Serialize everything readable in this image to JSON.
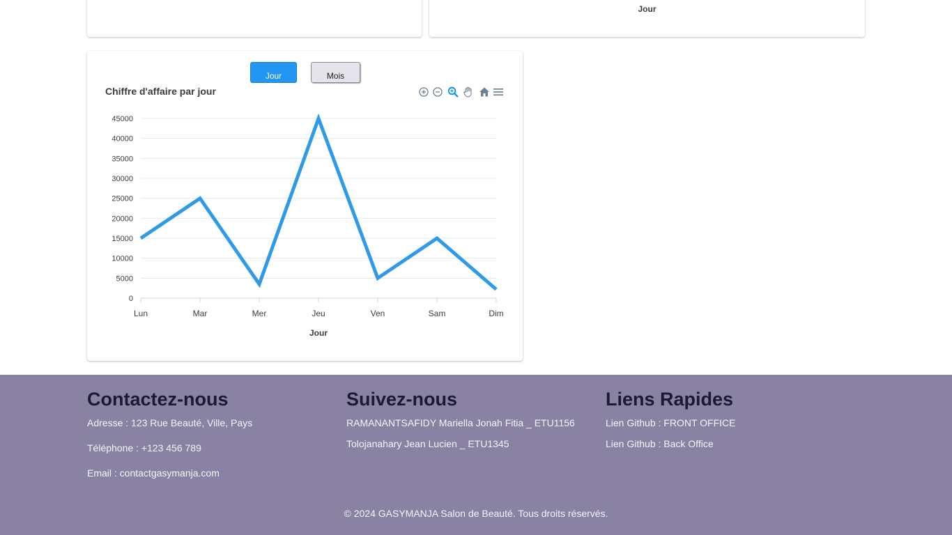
{
  "top_right_card": {
    "axis_title": "Jour"
  },
  "chart_card": {
    "buttons": {
      "day": "Jour",
      "month": "Mois"
    },
    "toolbar_icons": [
      "zoom-in-icon",
      "zoom-out-icon",
      "zoom-select-icon",
      "pan-hand-icon",
      "home-icon",
      "menu-icon"
    ]
  },
  "chart_data": {
    "type": "line",
    "title": "Chiffre d'affaire par jour",
    "xlabel": "Jour",
    "ylabel": "",
    "categories": [
      "Lun",
      "Mar",
      "Mer",
      "Jeu",
      "Ven",
      "Sam",
      "Dim"
    ],
    "series": [
      {
        "values": [
          15000,
          25000,
          3500,
          45000,
          5000,
          15000,
          2200
        ]
      }
    ],
    "ylim": [
      0,
      45000
    ],
    "yticks": [
      0,
      5000,
      10000,
      15000,
      20000,
      25000,
      30000,
      35000,
      40000,
      45000
    ],
    "grid": true,
    "line_color": "#2e9ae8"
  },
  "footer": {
    "contact": {
      "title": "Contactez-nous",
      "lines": [
        "Adresse : 123 Rue Beauté, Ville, Pays",
        "Téléphone : +123 456 789",
        "Email : contactgasymanja.com"
      ]
    },
    "follow": {
      "title": "Suivez-nous",
      "lines": [
        "RAMANANTSAFIDY Mariella Jonah Fitia _ ETU1156",
        "Tolojanahary Jean Lucien _ ETU1345"
      ]
    },
    "links": {
      "title": "Liens Rapides",
      "lines": [
        "Lien Github : FRONT OFFICE",
        "Lien Github : Back Office"
      ]
    },
    "copyright": "© 2024 GASYMANJA Salon de Beauté. Tous droits réservés.",
    "background": "#8a82a3"
  }
}
